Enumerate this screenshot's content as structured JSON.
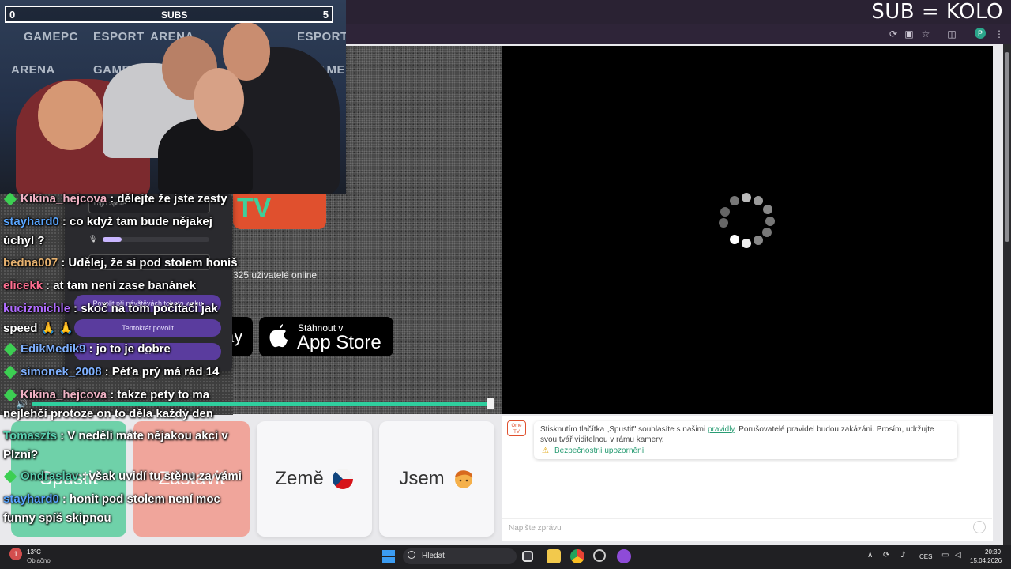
{
  "overlay_title": "SUB = KOLO",
  "browser": {
    "icons": [
      "translate-icon",
      "cast-icon",
      "bookmark-star-icon",
      "extensions-icon",
      "profile-avatar",
      "more-menu-icon"
    ],
    "profile_initial": "P"
  },
  "webcam": {
    "subs_left": "0",
    "subs_center": "SUBS",
    "subs_right": "5",
    "banner_texts": [
      "GAMEPC",
      "ESPORT",
      "ARENA"
    ]
  },
  "site": {
    "online_text": "325 uživatelé online",
    "gplay_fragment": "ay",
    "appstore_small": "Stáhnout v",
    "appstore_big": "App Store"
  },
  "permission_popup": {
    "field1": "Logi Capture",
    "allow_visits": "Povolit při návštěvách tohoto webu",
    "allow_once": "Tentokrát povolit",
    "deny_fragment": "at"
  },
  "tiles": {
    "start": "Spustit",
    "stop": "Zastavit",
    "country": "Země",
    "gender": "Jsem"
  },
  "notice": {
    "text_before": "Stisknutím tlačítka „Spustit\" souhlasíte s našimi ",
    "link": "pravidly",
    "text_after": ". Porušovatelé pravidel budou zakázáni. Prosím, udržujte svou tvář viditelnou v rámu kamery.",
    "safety_link": "Bezpečnostní upozornění",
    "logo_text": "Ome TV"
  },
  "message_placeholder": "Napište zprávu",
  "chat": [
    {
      "diamond": true,
      "user": "Kikina_hejcova",
      "color": "#f1b3c5",
      "text": ": dělejte že jste zesty",
      "cont": ""
    },
    {
      "diamond": false,
      "user": "stayhard0",
      "color": "#5aa6ff",
      "text": ": co když tam bude nějakej",
      "cont": "úchyl ?"
    },
    {
      "diamond": false,
      "user": "bedna007",
      "color": "#e7b26f",
      "text": ": Udělej, že si pod stolem honíš",
      "cont": ""
    },
    {
      "diamond": false,
      "user": "elicekk",
      "color": "#ff6f91",
      "text": ": at tam není zase banánek",
      "cont": ""
    },
    {
      "diamond": false,
      "user": "kucizmichle",
      "color": "#b06cff",
      "text": ": skoč na tom počítači jak",
      "cont": "speed 🙏 🙏"
    },
    {
      "diamond": true,
      "user": "EdikMedik9",
      "color": "#7fb1ff",
      "text": ": jo to je dobre",
      "cont": ""
    },
    {
      "diamond": true,
      "user": "simonek_2008",
      "color": "#7fb1ff",
      "text": ": Péťa prý má rád 14",
      "cont": ""
    },
    {
      "diamond": true,
      "user": "Kikina_hejcova",
      "color": "#f1b3c5",
      "text": ": takze pety to ma",
      "cont": "nejlehčí protoze on to děla každý den"
    },
    {
      "diamond": false,
      "user": "Tomaszts",
      "color": "#5ad1b0",
      "text": ": V neděli máte nějakou akci v",
      "cont": "Plzni?"
    },
    {
      "diamond": true,
      "user": "Ondraslav",
      "color": "#5ad1b0",
      "text": ": však uvidí tu stěnu za vámi",
      "cont": ""
    },
    {
      "diamond": false,
      "user": "stayhard0",
      "color": "#5aa6ff",
      "text": ": honit pod stolem není moc",
      "cont": "funny spíš skipnou"
    }
  ],
  "taskbar": {
    "weather_badge": "1",
    "temp": "13°C",
    "weather": "Oblačno",
    "search": "Hledat",
    "lang": "CES",
    "time": "20:39",
    "date": "15.04.2026"
  },
  "colors": {
    "accent_green": "#2fcf9e",
    "start_tile": "#6fd1a9",
    "stop_tile": "#f0a59b",
    "brand_red": "#e0502e"
  }
}
